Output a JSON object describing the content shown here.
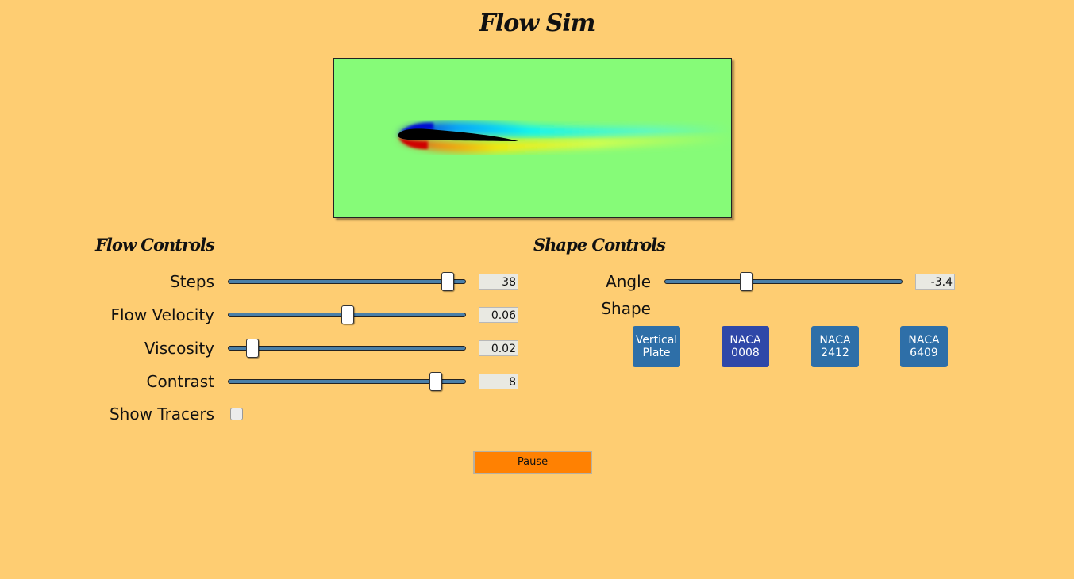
{
  "app": {
    "title": "Flow Sim"
  },
  "flow_controls": {
    "heading": "Flow Controls",
    "steps": {
      "label": "Steps",
      "value": "38",
      "fraction": 0.92
    },
    "velocity": {
      "label": "Flow Velocity",
      "value": "0.06",
      "fraction": 0.5
    },
    "viscosity": {
      "label": "Viscosity",
      "value": "0.02",
      "fraction": 0.1
    },
    "contrast": {
      "label": "Contrast",
      "value": "8",
      "fraction": 0.87
    },
    "tracers": {
      "label": "Show Tracers",
      "checked": false
    }
  },
  "shape_controls": {
    "heading": "Shape Controls",
    "angle": {
      "label": "Angle",
      "value": "-3.4",
      "fraction": 0.34
    },
    "shape_label": "Shape",
    "shapes": [
      {
        "label": "Vertical\nPlate",
        "color": "#2e6fa8"
      },
      {
        "label": "NACA\n0008",
        "color": "#2f48a8"
      },
      {
        "label": "NACA\n2412",
        "color": "#2e6fa8"
      },
      {
        "label": "NACA\n6409",
        "color": "#2e6fa8"
      }
    ]
  },
  "pause_label": "Pause",
  "colors": {
    "background": "#fecd72",
    "slider_track": "#4a7fa8",
    "pause": "#ff8102"
  }
}
